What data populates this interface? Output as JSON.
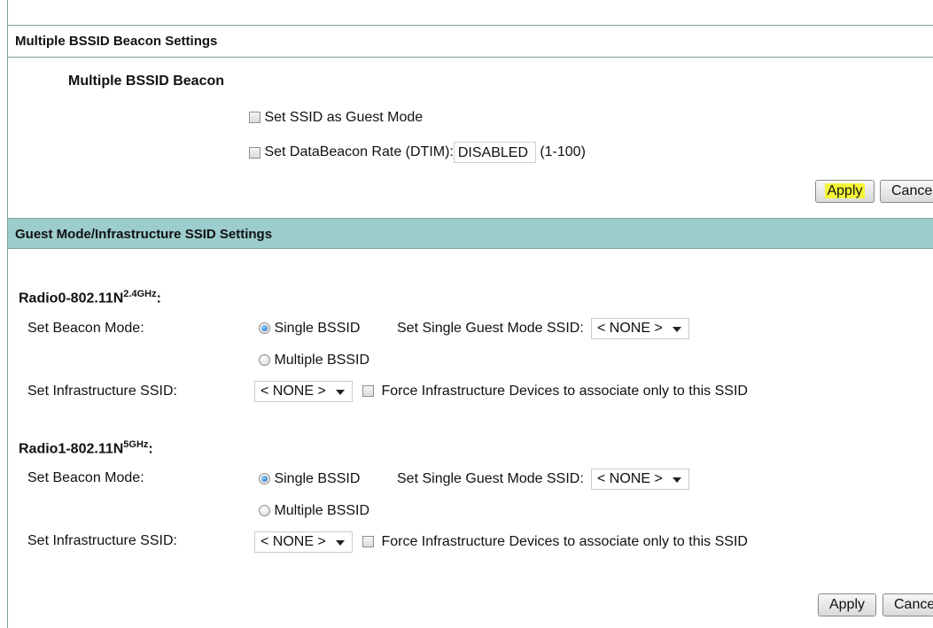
{
  "multiple_bssid_section": {
    "title": "Multiple BSSID Beacon Settings",
    "subtitle": "Multiple BSSID Beacon",
    "guest_mode_checkbox": {
      "label": "Set SSID as Guest Mode",
      "checked": false
    },
    "dtim_checkbox": {
      "label": "Set DataBeacon Rate (DTIM):",
      "checked": false
    },
    "dtim_value": "DISABLED",
    "dtim_range": "(1-100)",
    "apply_label": "Apply",
    "cancel_label": "Cance"
  },
  "guest_section": {
    "title": "Guest Mode/Infrastructure SSID Settings",
    "radios": [
      {
        "name": "Radio0-802.11N",
        "band": "2.4GHz",
        "suffix": ":",
        "beacon_mode_label": "Set Beacon Mode:",
        "single_label": "Single BSSID",
        "multiple_label": "Multiple BSSID",
        "selected_mode": "Single BSSID",
        "guest_ssid_label": "Set Single Guest Mode SSID:",
        "guest_ssid_value": "< NONE >",
        "infra_label": "Set Infrastructure SSID:",
        "infra_value": "< NONE >",
        "force_label": "Force Infrastructure Devices to associate only to this SSID",
        "force_checked": false
      },
      {
        "name": "Radio1-802.11N",
        "band": "5GHz",
        "suffix": ":",
        "beacon_mode_label": "Set Beacon Mode:",
        "single_label": "Single BSSID",
        "multiple_label": "Multiple BSSID",
        "selected_mode": "Single BSSID",
        "guest_ssid_label": "Set Single Guest Mode SSID:",
        "guest_ssid_value": "< NONE >",
        "infra_label": "Set Infrastructure SSID:",
        "infra_value": "< NONE >",
        "force_label": "Force Infrastructure Devices to associate only to this SSID",
        "force_checked": false
      }
    ],
    "apply_label": "Apply",
    "cancel_label": "Cance"
  },
  "colors": {
    "section_header_bg": "#9ccccc",
    "rule": "#7f9fa3",
    "highlight": "#f5f53a",
    "radio_selected": "#1565b8"
  }
}
